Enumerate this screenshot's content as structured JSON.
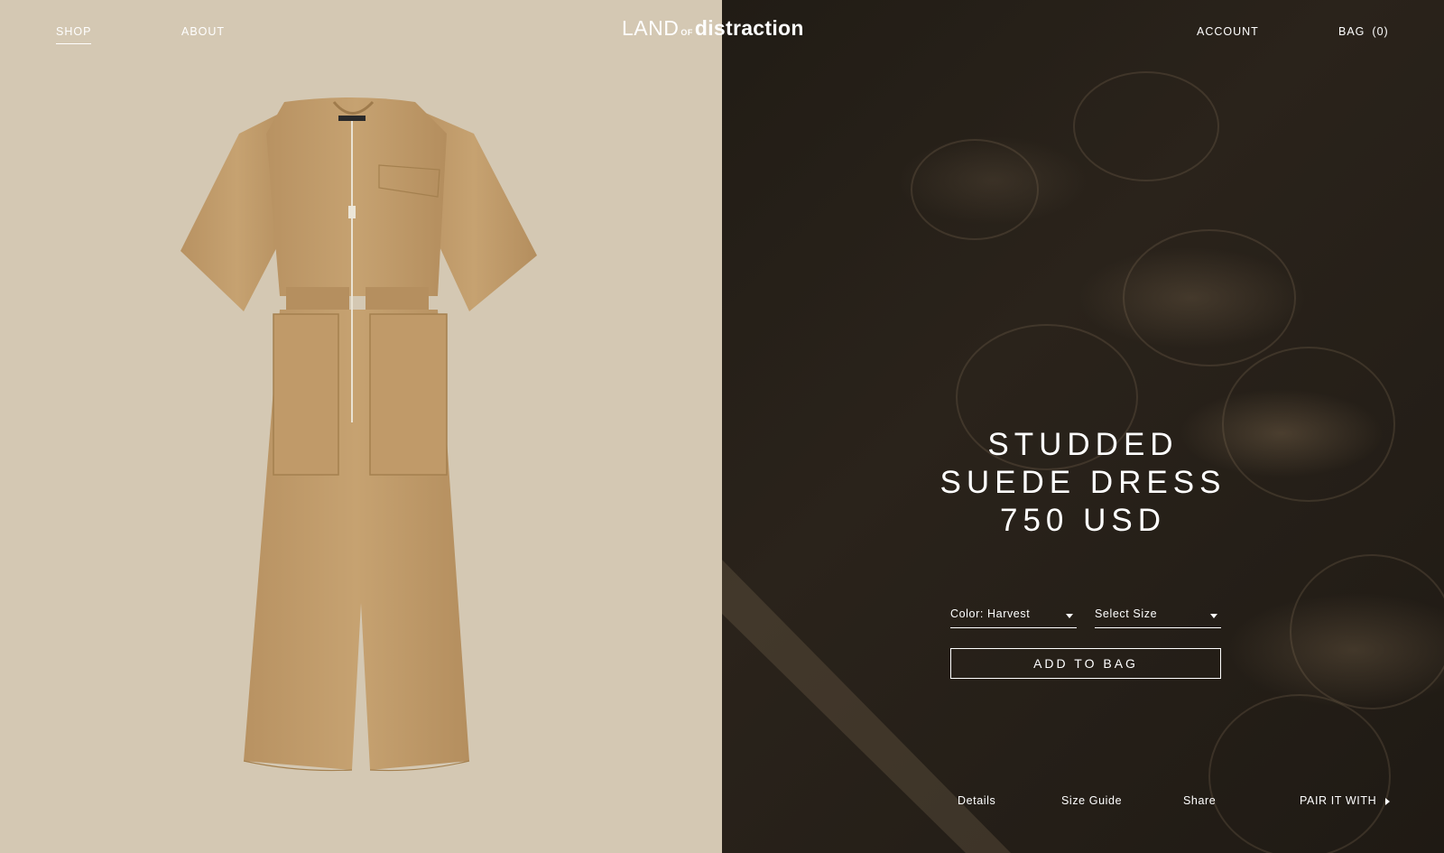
{
  "header": {
    "nav_left": [
      {
        "label": "SHOP",
        "active": true
      },
      {
        "label": "ABOUT",
        "active": false
      }
    ],
    "logo": {
      "part1": "LAND",
      "part2": "OF",
      "part3": "distraction"
    },
    "account_label": "ACCOUNT",
    "bag_label": "BAG",
    "bag_count": "(0)"
  },
  "product": {
    "title_line1": "STUDDED",
    "title_line2": "SUEDE DRESS",
    "price": "750 USD",
    "color_select": "Color: Harvest",
    "size_select": "Select Size",
    "add_to_bag": "ADD TO BAG"
  },
  "footer_links": {
    "details": "Details",
    "size_guide": "Size Guide",
    "share": "Share",
    "pair_it_with": "PAIR IT WITH"
  },
  "colors": {
    "left_background": "#d4c8b3",
    "garment": "#c4a070",
    "right_background": "#211c15",
    "text": "#ffffff"
  },
  "icons": [
    "chevron-down-icon",
    "chevron-right-icon"
  ]
}
